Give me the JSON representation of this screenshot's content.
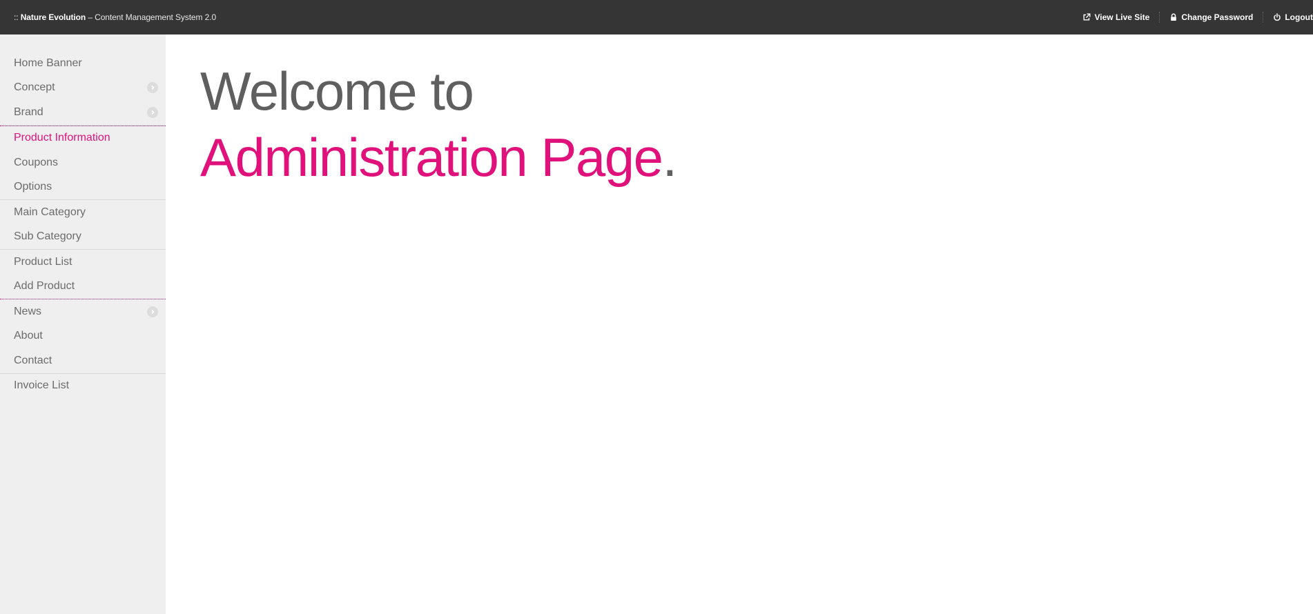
{
  "topbar": {
    "prefix": ":: ",
    "brand": "Nature Evolution",
    "rest": " – Content Management System 2.0",
    "actions": [
      {
        "label": "View Live Site",
        "icon": "external-link-icon"
      },
      {
        "label": "Change Password",
        "icon": "lock-icon"
      },
      {
        "label": "Logout",
        "icon": "power-icon"
      }
    ]
  },
  "sidebar": {
    "groups": [
      {
        "items": [
          {
            "label": "Home Banner",
            "submenu": false
          },
          {
            "label": "Concept",
            "submenu": true
          },
          {
            "label": "Brand",
            "submenu": true
          }
        ]
      },
      {
        "items": [
          {
            "label": "Product Information",
            "active": true
          },
          {
            "label": "Coupons"
          },
          {
            "label": "Options"
          }
        ]
      },
      {
        "items": [
          {
            "label": "Main Category"
          },
          {
            "label": "Sub Category"
          }
        ]
      },
      {
        "items": [
          {
            "label": "Product List"
          },
          {
            "label": "Add Product"
          }
        ]
      },
      {
        "items": [
          {
            "label": "News",
            "submenu": true
          },
          {
            "label": "About"
          },
          {
            "label": "Contact"
          }
        ]
      },
      {
        "items": [
          {
            "label": "Invoice List"
          }
        ]
      }
    ]
  },
  "main": {
    "welcome_line1": "Welcome to",
    "welcome_line2": "Administration Page",
    "welcome_dot": "."
  },
  "colors": {
    "accent": "#e0117a",
    "topbar": "#353535",
    "sidebar": "#efefef",
    "text": "#6b6b6b"
  }
}
